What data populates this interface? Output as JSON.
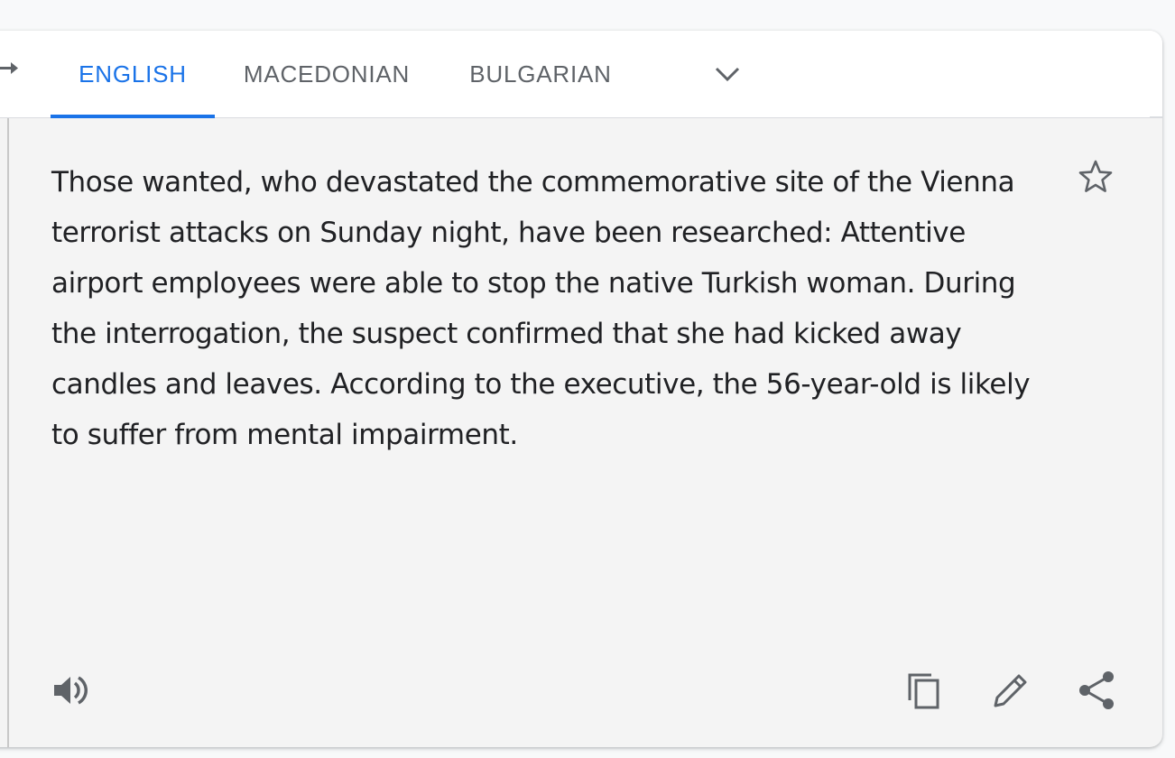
{
  "tabs": [
    {
      "label": "ENGLISH",
      "active": true
    },
    {
      "label": "MACEDONIAN",
      "active": false
    },
    {
      "label": "BULGARIAN",
      "active": false
    }
  ],
  "icons": {
    "swap": "swap-languages-icon",
    "more_languages": "chevron-down-icon",
    "star": "star-outline-icon",
    "listen": "speaker-icon",
    "copy": "copy-icon",
    "edit": "pencil-icon",
    "share": "share-icon"
  },
  "translation": {
    "text": "Those wanted, who devastated the commemorative site of the Vienna terrorist attacks on Sunday night, have been researched: Attentive airport employees were able to stop the native Turkish woman. During the interrogation, the suspect confirmed that she had kicked away candles and leaves. According to the executive, the 56-year-old is likely to suffer from mental impairment."
  },
  "colors": {
    "accent": "#1a73e8",
    "icon": "#5f6368",
    "text": "#202124",
    "panel_background": "#f4f4f4"
  }
}
